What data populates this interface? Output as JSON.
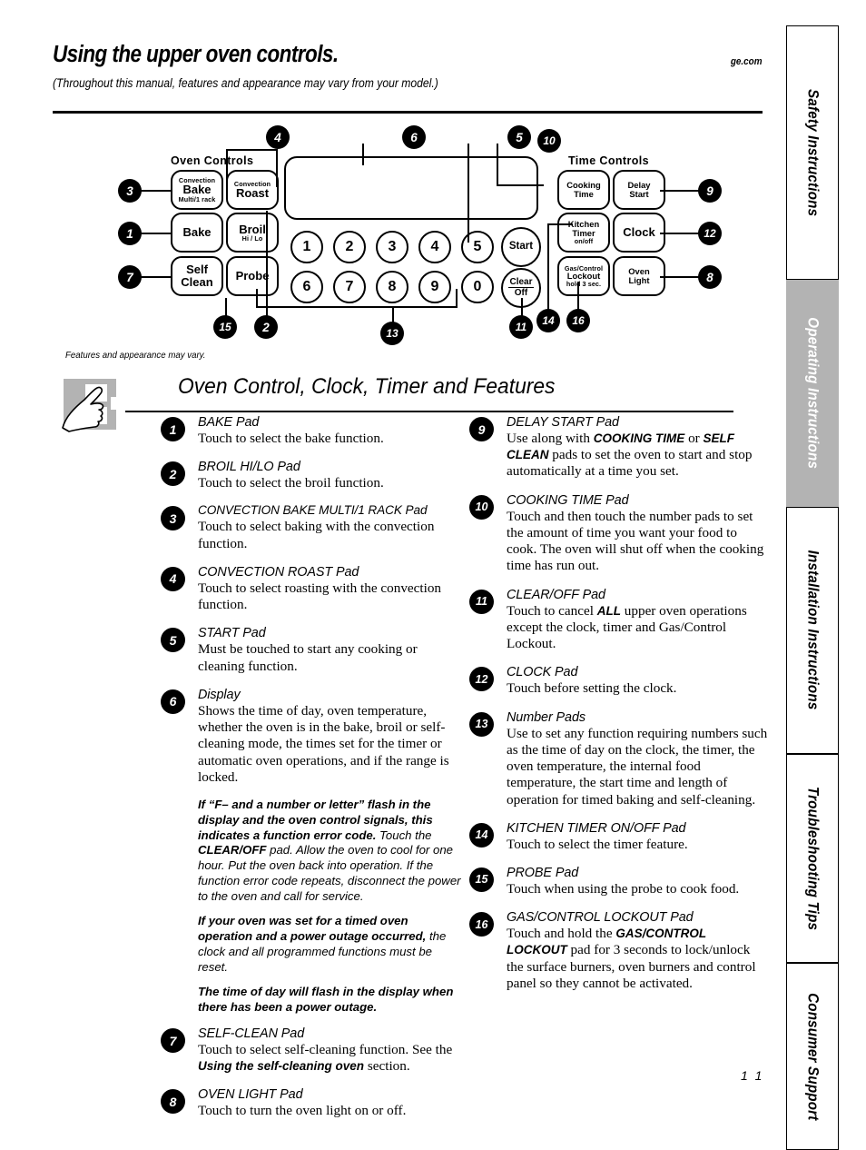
{
  "header": {
    "title": "Using the upper oven controls.",
    "site": "ge.com",
    "subtitle": "(Throughout this manual, features and appearance may vary from your model.)"
  },
  "sidebar": {
    "tabs": [
      {
        "label": "Safety Instructions",
        "active": false
      },
      {
        "label": "Operating Instructions",
        "active": true
      },
      {
        "label": "Installation Instructions",
        "active": false
      },
      {
        "label": "Troubleshooting Tips",
        "active": false
      },
      {
        "label": "Consumer Support",
        "active": false
      }
    ]
  },
  "diagram": {
    "group_oven": "Oven Controls",
    "group_time": "Time Controls",
    "caption": "Features and appearance may vary.",
    "pads": {
      "convection_bake_l1": "Convection",
      "convection_bake_l2": "Bake",
      "convection_bake_l3": "Multi/1 rack",
      "convection_roast_l1": "Convection",
      "convection_roast_l2": "Roast",
      "bake": "Bake",
      "broil_l1": "Broil",
      "broil_l2": "Hi / Lo",
      "self_clean_l1": "Self",
      "self_clean_l2": "Clean",
      "probe": "Probe",
      "start": "Start",
      "clear_l1": "Clear",
      "clear_l2": "Off",
      "cooking_time_l1": "Cooking",
      "cooking_time_l2": "Time",
      "delay_start_l1": "Delay",
      "delay_start_l2": "Start",
      "kitchen_timer_l1": "Kitchen",
      "kitchen_timer_l2": "Timer",
      "kitchen_timer_l3": "on/off",
      "clock": "Clock",
      "lockout_l1": "Gas/Control",
      "lockout_l2": "Lockout",
      "lockout_l3": "hold 3 sec.",
      "oven_light_l1": "Oven",
      "oven_light_l2": "Light"
    },
    "number_pads": [
      "1",
      "2",
      "3",
      "4",
      "5",
      "6",
      "7",
      "8",
      "9",
      "0"
    ],
    "callouts": [
      "1",
      "2",
      "3",
      "4",
      "5",
      "6",
      "7",
      "8",
      "9",
      "10",
      "11",
      "12",
      "13",
      "14",
      "15",
      "16"
    ]
  },
  "section": {
    "title": "Oven Control, Clock, Timer and Features"
  },
  "left_items": [
    {
      "num": "1",
      "title": "BAKE Pad",
      "body": "Touch to select the bake function."
    },
    {
      "num": "2",
      "title": "BROIL HI/LO Pad",
      "body": "Touch to select the broil function."
    },
    {
      "num": "3",
      "title": "CONVECTION BAKE MULTI/1 RACK Pad",
      "body": "Touch to select baking with the convection function."
    },
    {
      "num": "4",
      "title": "CONVECTION ROAST Pad",
      "body": "Touch to select roasting with the convection function."
    },
    {
      "num": "5",
      "title": "START Pad",
      "body": "Must be touched to start any cooking or cleaning function."
    },
    {
      "num": "6",
      "title": "Display",
      "body": "Shows the time of day, oven temperature, whether the oven is in the bake, broil or self-cleaning mode, the times set for the timer or automatic oven operations, and if the range is locked."
    }
  ],
  "notes": [
    {
      "bold_lead": "If “F– and a number or letter” flash in the display and the oven control signals, this indicates a function error code.",
      "rest_a": " Touch the ",
      "emph": "CLEAR/OFF",
      "rest_b": " pad. Allow the oven to cool for one hour. Put the oven back into operation. If the function error code repeats, disconnect the power to the oven and call for service."
    },
    {
      "bold_lead": "If your oven was set for a timed oven operation and a power outage occurred,",
      "rest_a": " the clock and all programmed functions must be reset.",
      "emph": "",
      "rest_b": ""
    },
    {
      "bold_lead": "The time of day will flash in the display when there has been a power outage.",
      "rest_a": "",
      "emph": "",
      "rest_b": ""
    }
  ],
  "left_items_tail": [
    {
      "num": "7",
      "title": "SELF-CLEAN Pad",
      "body_a": "Touch to select self-cleaning function. See the ",
      "emph": "Using the self-cleaning oven",
      "body_b": " section."
    },
    {
      "num": "8",
      "title": "OVEN LIGHT Pad",
      "body_a": "Touch to turn the oven light on or off.",
      "emph": "",
      "body_b": ""
    }
  ],
  "right_items": [
    {
      "num": "9",
      "title": "DELAY START Pad",
      "body_a": "Use along with ",
      "emph1": "COOKING TIME",
      "body_b": " or ",
      "emph2": "SELF CLEAN",
      "body_c": " pads to set the oven to start and stop automatically at a time you set."
    },
    {
      "num": "10",
      "title": "COOKING TIME Pad",
      "body_a": "Touch and then touch the number pads to set the amount of time you want your food to cook. The oven will shut off when the cooking time has run out.",
      "emph1": "",
      "body_b": "",
      "emph2": "",
      "body_c": ""
    },
    {
      "num": "11",
      "title": "CLEAR/OFF Pad",
      "body_a": "Touch to cancel ",
      "emph1": "ALL",
      "body_b": "  upper oven operations except the clock, timer and Gas/Control Lockout.",
      "emph2": "",
      "body_c": ""
    },
    {
      "num": "12",
      "title": "CLOCK Pad",
      "body_a": "Touch before setting the clock.",
      "emph1": "",
      "body_b": "",
      "emph2": "",
      "body_c": ""
    },
    {
      "num": "13",
      "title": "Number Pads",
      "body_a": "Use to set any function requiring numbers such as the time of day on the clock, the timer, the oven temperature, the internal food temperature, the start time and length of operation for timed baking and self-cleaning.",
      "emph1": "",
      "body_b": "",
      "emph2": "",
      "body_c": ""
    },
    {
      "num": "14",
      "title": "KITCHEN TIMER ON/OFF Pad",
      "body_a": "Touch to select the timer feature.",
      "emph1": "",
      "body_b": "",
      "emph2": "",
      "body_c": ""
    },
    {
      "num": "15",
      "title": "PROBE Pad",
      "body_a": "Touch when using the probe to cook food.",
      "emph1": "",
      "body_b": "",
      "emph2": "",
      "body_c": ""
    },
    {
      "num": "16",
      "title": "GAS/CONTROL LOCKOUT Pad",
      "body_a": "Touch and hold the ",
      "emph1": "GAS/CONTROL LOCKOUT",
      "body_b": " pad for 3 seconds to lock/unlock the surface burners, oven burners and control panel so they cannot be activated.",
      "emph2": "",
      "body_c": ""
    }
  ],
  "footer": {
    "page_number": "1 1"
  }
}
